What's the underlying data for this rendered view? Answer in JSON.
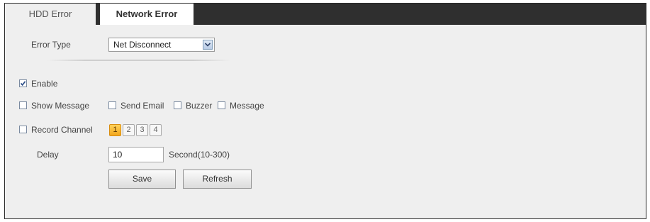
{
  "tabs": [
    {
      "label": "HDD Error",
      "active": false
    },
    {
      "label": "Network Error",
      "active": true
    }
  ],
  "error_type": {
    "label": "Error Type",
    "selected": "Net Disconnect"
  },
  "enable": {
    "label": "Enable",
    "checked": true
  },
  "show_message": {
    "label": "Show Message",
    "checked": false
  },
  "send_email": {
    "label": "Send Email",
    "checked": false
  },
  "buzzer": {
    "label": "Buzzer",
    "checked": false
  },
  "message": {
    "label": "Message",
    "checked": false
  },
  "record_channel": {
    "label": "Record Channel",
    "checked": false,
    "channels": [
      "1",
      "2",
      "3",
      "4"
    ],
    "selected": "1"
  },
  "delay": {
    "label": "Delay",
    "value": "10",
    "unit": "Second(10-300)"
  },
  "buttons": {
    "save": "Save",
    "refresh": "Refresh"
  },
  "colors": {
    "tab_bar": "#2f2f2f",
    "panel": "#efefef",
    "active_channel": "#f2a51c",
    "checkmark": "#2b4d88"
  }
}
